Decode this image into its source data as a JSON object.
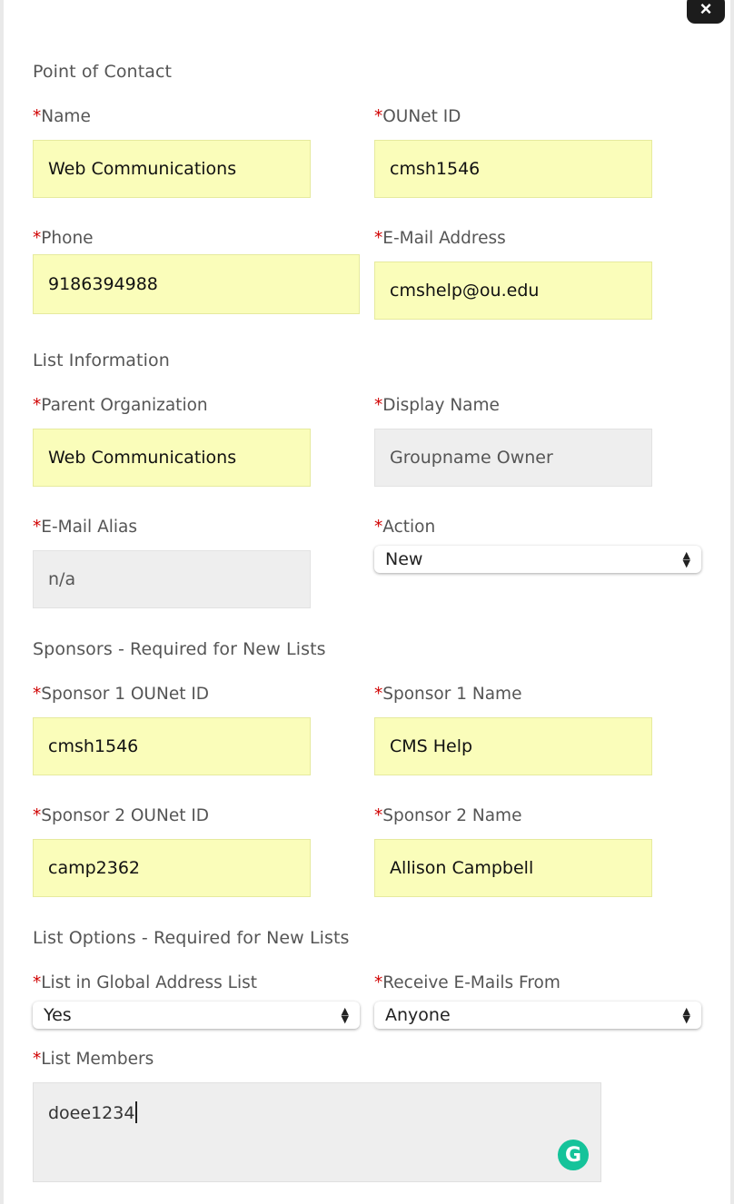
{
  "close_icon": "×",
  "sections": {
    "contact": "Point of Contact",
    "list_info": "List Information",
    "sponsors": "Sponsors - Required for New Lists",
    "options": "List Options - Required for New Lists"
  },
  "required_mark": "*",
  "fields": {
    "name": {
      "label": "Name",
      "value": "Web Communications"
    },
    "ounet_id": {
      "label": "OUNet ID",
      "value": "cmsh1546"
    },
    "phone": {
      "label": "Phone",
      "value": "9186394988"
    },
    "email": {
      "label": "E-Mail Address",
      "value": "cmshelp@ou.edu"
    },
    "parent_org": {
      "label": "Parent Organization",
      "value": "Web Communications"
    },
    "display_name": {
      "label": "Display Name",
      "value": "Groupname Owner"
    },
    "email_alias": {
      "label": "E-Mail Alias",
      "value": "n/a"
    },
    "action": {
      "label": "Action",
      "value": "New"
    },
    "sponsor1_id": {
      "label": "Sponsor 1 OUNet ID",
      "value": "cmsh1546"
    },
    "sponsor1_name": {
      "label": "Sponsor 1 Name",
      "value": "CMS Help"
    },
    "sponsor2_id": {
      "label": "Sponsor 2 OUNet ID",
      "value": "camp2362"
    },
    "sponsor2_name": {
      "label": "Sponsor 2 Name",
      "value": "Allison Campbell"
    },
    "gal": {
      "label": "List in Global Address List",
      "value": "Yes"
    },
    "receive_from": {
      "label": "Receive E-Mails From",
      "value": "Anyone"
    },
    "members": {
      "label": "List Members",
      "value": "doee1234"
    }
  },
  "grammarly_icon": "G",
  "colors": {
    "required": "#d00000",
    "field_bg": "#fafdba",
    "readonly_bg": "#eeeeee",
    "grammarly": "#15c39a"
  }
}
